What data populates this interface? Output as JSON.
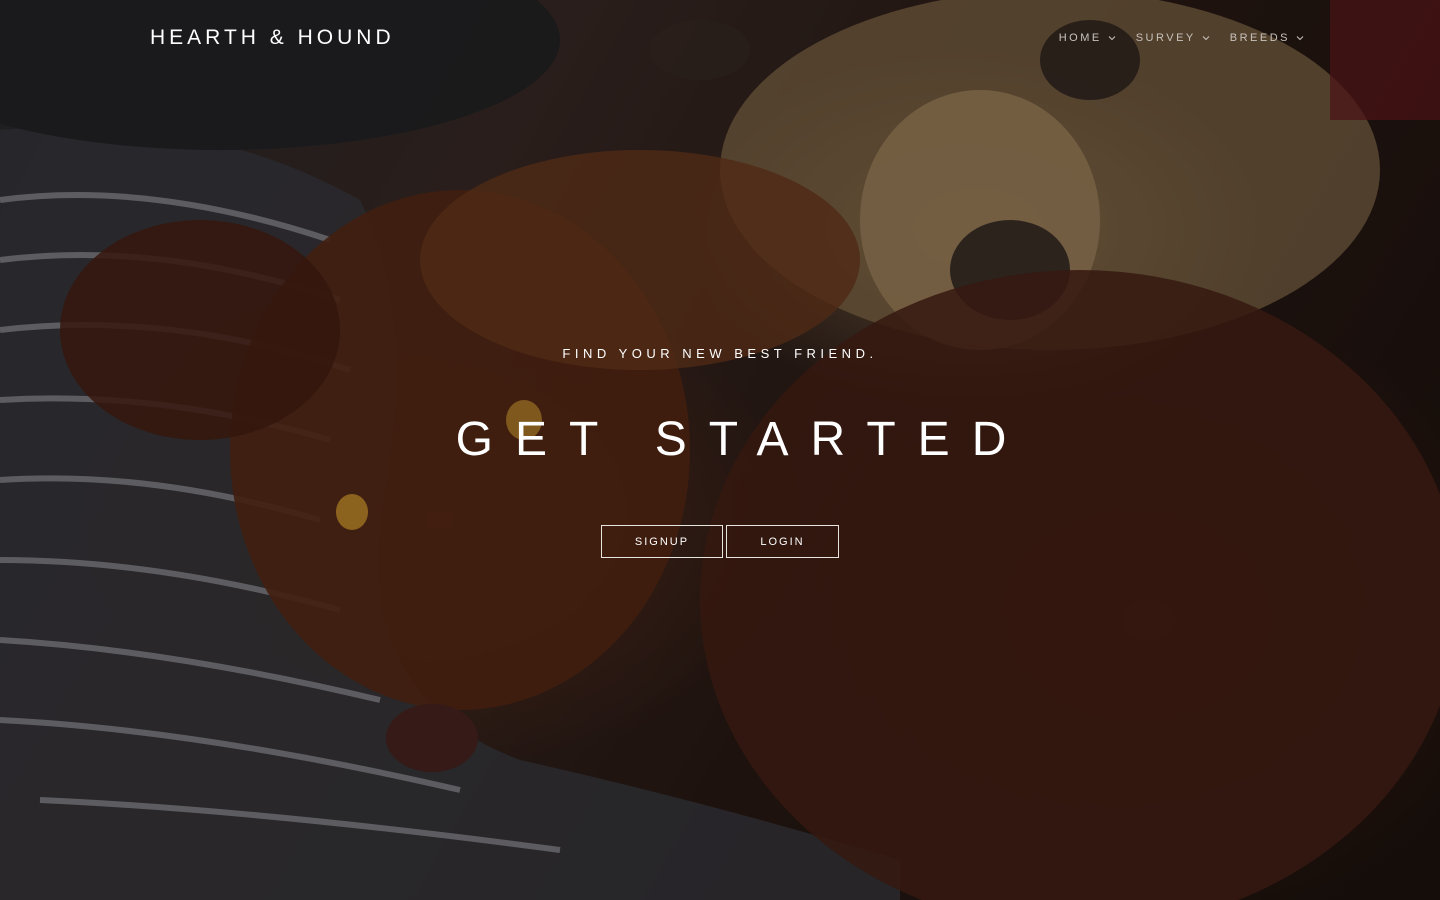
{
  "brand": {
    "name": "HEARTH & HOUND"
  },
  "nav": {
    "items": [
      {
        "label": "HOME",
        "icon": "chevron-down-icon"
      },
      {
        "label": "SURVEY",
        "icon": "chevron-down-icon"
      },
      {
        "label": "BREEDS",
        "icon": "chevron-down-icon"
      }
    ]
  },
  "hero": {
    "tagline": "FIND YOUR NEW BEST FRIEND.",
    "headline": "GET STARTED",
    "buttons": {
      "signup_label": "SIGNUP",
      "login_label": "LOGIN"
    },
    "background_image": "photo-dogs-on-blanket"
  },
  "colors": {
    "text": "#ffffff",
    "nav_text": "#c8c2bd",
    "button_border": "#e8e4e0"
  }
}
